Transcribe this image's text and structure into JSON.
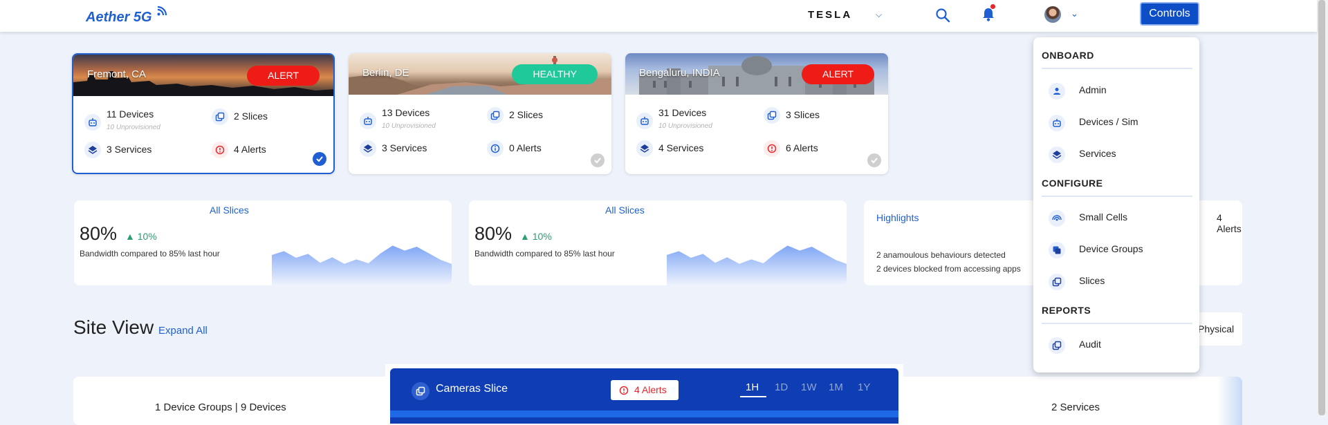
{
  "header": {
    "logo": "Aether 5G",
    "org": "TESLA",
    "controls_label": "Controls"
  },
  "sites": [
    {
      "name": "Fremont, CA",
      "status": "ALERT",
      "devices": "11 Devices",
      "unprovisioned": "10 Unprovisioned",
      "slices": "2 Slices",
      "services": "3 Services",
      "alerts": "4 Alerts",
      "selected": true
    },
    {
      "name": "Berlin, DE",
      "status": "HEALTHY",
      "devices": "13 Devices",
      "unprovisioned": "10 Unprovisioned",
      "slices": "2 Slices",
      "services": "3 Services",
      "alerts": "0 Alerts",
      "selected": false
    },
    {
      "name": "Bengaluru, INDIA",
      "status": "ALERT",
      "devices": "31 Devices",
      "unprovisioned": "10 Unprovisioned",
      "slices": "3 Slices",
      "services": "4 Services",
      "alerts": "6 Alerts",
      "selected": false
    }
  ],
  "metrics": [
    {
      "title": "All Slices",
      "value": "80%",
      "change": "10%",
      "desc": "Bandwidth compared to 85% last hour",
      "sparkline": [
        55,
        62,
        50,
        57,
        41,
        51,
        39,
        47,
        40,
        58,
        72,
        63,
        70,
        58,
        46,
        38
      ]
    },
    {
      "title": "All Slices",
      "value": "80%",
      "change": "10%",
      "desc": "Bandwidth compared to 85% last hour",
      "sparkline": [
        55,
        62,
        50,
        57,
        41,
        51,
        39,
        47,
        40,
        58,
        72,
        63,
        70,
        58,
        46,
        38
      ]
    }
  ],
  "highlights": {
    "title": "Highlights",
    "alerts_partial": "4 Alerts",
    "lines": [
      "2 anamoulous behaviours detected",
      "2 devices blocked from accessing apps"
    ]
  },
  "site_view": {
    "title": "Site View",
    "expand_all": "Expand All",
    "physical": "Physical",
    "device_groups": "1 Device Groups | 9 Devices",
    "services": "2 Services"
  },
  "slice_panel": {
    "name": "Cameras Slice",
    "alerts": "4 Alerts",
    "ranges": [
      "1H",
      "1D",
      "1W",
      "1M",
      "1Y"
    ],
    "active_range": "1H"
  },
  "menu": {
    "sections": [
      {
        "title": "ONBOARD",
        "items": [
          {
            "label": "Admin",
            "icon": "person-icon"
          },
          {
            "label": "Devices / Sim",
            "icon": "robot-icon"
          },
          {
            "label": "Services",
            "icon": "layers-icon"
          }
        ]
      },
      {
        "title": "CONFIGURE",
        "items": [
          {
            "label": "Small Cells",
            "icon": "antenna-icon"
          },
          {
            "label": "Device Groups",
            "icon": "device-group-icon"
          },
          {
            "label": "Slices",
            "icon": "slices-icon"
          }
        ]
      },
      {
        "title": "REPORTS",
        "items": [
          {
            "label": "Audit",
            "icon": "audit-icon"
          }
        ]
      }
    ]
  },
  "colors": {
    "accent": "#1f5fd1",
    "alert": "#ee1b17",
    "healthy": "#20c99a",
    "slice_panel": "#0e3db4"
  }
}
